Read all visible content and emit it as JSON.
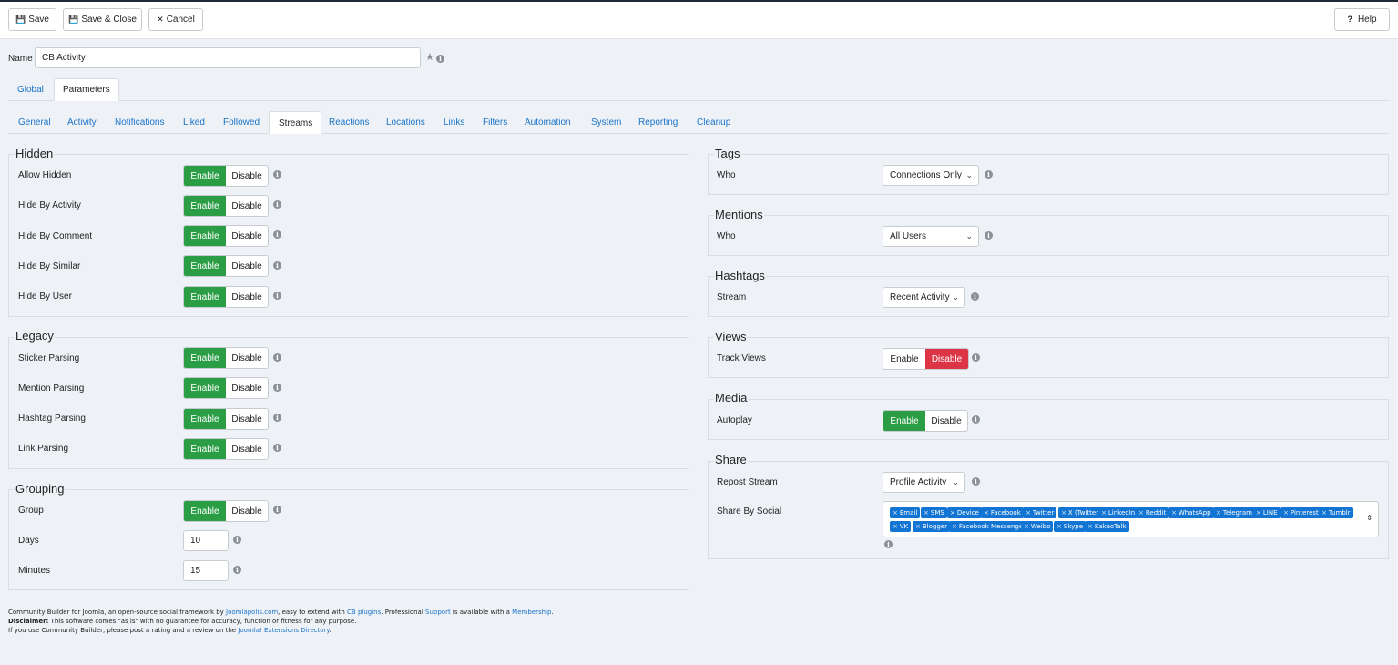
{
  "toolbar": {
    "save_label": "Save",
    "save_close_label": "Save & Close",
    "cancel_label": "Cancel",
    "help_label": "Help",
    "save_icon": "floppy-icon",
    "save_close_icon": "floppy-icon",
    "cancel_icon": "times-icon",
    "help_icon": "question-icon"
  },
  "name_field": {
    "label": "Name",
    "value": "CB Activity"
  },
  "main_tabs": [
    {
      "label": "Global"
    },
    {
      "label": "Parameters",
      "active": true
    }
  ],
  "sub_tabs": [
    {
      "label": "General"
    },
    {
      "label": "Activity"
    },
    {
      "label": "Notifications"
    },
    {
      "label": "Liked"
    },
    {
      "label": "Followed"
    },
    {
      "label": "Streams",
      "active": true
    },
    {
      "label": "Reactions"
    },
    {
      "label": "Locations"
    },
    {
      "label": "Links"
    },
    {
      "label": "Filters"
    },
    {
      "label": "Automation"
    },
    {
      "label": "System"
    },
    {
      "label": "Reporting"
    },
    {
      "label": "Cleanup"
    }
  ],
  "toggle_labels": {
    "enable": "Enable",
    "disable": "Disable"
  },
  "hidden": {
    "title": "Hidden",
    "rows": [
      {
        "label": "Allow Hidden",
        "value": "Enable"
      },
      {
        "label": "Hide By Activity",
        "value": "Enable"
      },
      {
        "label": "Hide By Comment",
        "value": "Enable"
      },
      {
        "label": "Hide By Similar",
        "value": "Enable"
      },
      {
        "label": "Hide By User",
        "value": "Enable"
      }
    ]
  },
  "legacy": {
    "title": "Legacy",
    "rows": [
      {
        "label": "Sticker Parsing",
        "value": "Enable"
      },
      {
        "label": "Mention Parsing",
        "value": "Enable"
      },
      {
        "label": "Hashtag Parsing",
        "value": "Enable"
      },
      {
        "label": "Link Parsing",
        "value": "Enable"
      }
    ]
  },
  "grouping": {
    "title": "Grouping",
    "group": {
      "label": "Group",
      "value": "Enable"
    },
    "days": {
      "label": "Days",
      "value": "10"
    },
    "minutes": {
      "label": "Minutes",
      "value": "15"
    }
  },
  "tags": {
    "title": "Tags",
    "who_label": "Who",
    "who_value": "Connections Only"
  },
  "mentions": {
    "title": "Mentions",
    "who_label": "Who",
    "who_value": "All Users"
  },
  "hashtags": {
    "title": "Hashtags",
    "stream_label": "Stream",
    "stream_value": "Recent Activity"
  },
  "views": {
    "title": "Views",
    "track_label": "Track Views",
    "value": "Disable"
  },
  "media": {
    "title": "Media",
    "autoplay_label": "Autoplay",
    "value": "Enable"
  },
  "share": {
    "title": "Share",
    "repost_label": "Repost Stream",
    "repost_value": "Profile Activity",
    "social_label": "Share By Social",
    "social_selected": [
      "Email",
      "SMS",
      "Device",
      "Facebook",
      "Twitter",
      "X (Twitter)",
      "LinkedIn",
      "Reddit",
      "WhatsApp",
      "Telegram",
      "LINE",
      "Pinterest",
      "Tumblr",
      "VK",
      "Blogger",
      "Facebook Messenger",
      "Weibo",
      "Skype",
      "KakaoTalk"
    ]
  },
  "footer": {
    "l1_a": "Community Builder for Joomla, an open-source social framework by ",
    "l1_link1": "Joomlapolis.com",
    "l1_b": ", easy to extend with ",
    "l1_link2": "CB plugins",
    "l1_c": ". Professional ",
    "l1_link3": "Support",
    "l1_d": " is available with a ",
    "l1_link4": "Membership",
    "l1_e": ".",
    "l2_bold": "Disclaimer:",
    "l2_text": " This software comes \"as is\" with no guarantee for accuracy, function or fitness for any purpose.",
    "l3_a": "If you use Community Builder, please post a rating and a review on the ",
    "l3_link": "Joomla! Extensions Directory",
    "l3_b": "."
  },
  "colors": {
    "enable_green": "#2a9d45",
    "disable_red": "#dc3545",
    "chip_blue": "#1275d4",
    "link_blue": "#1a73c8"
  }
}
